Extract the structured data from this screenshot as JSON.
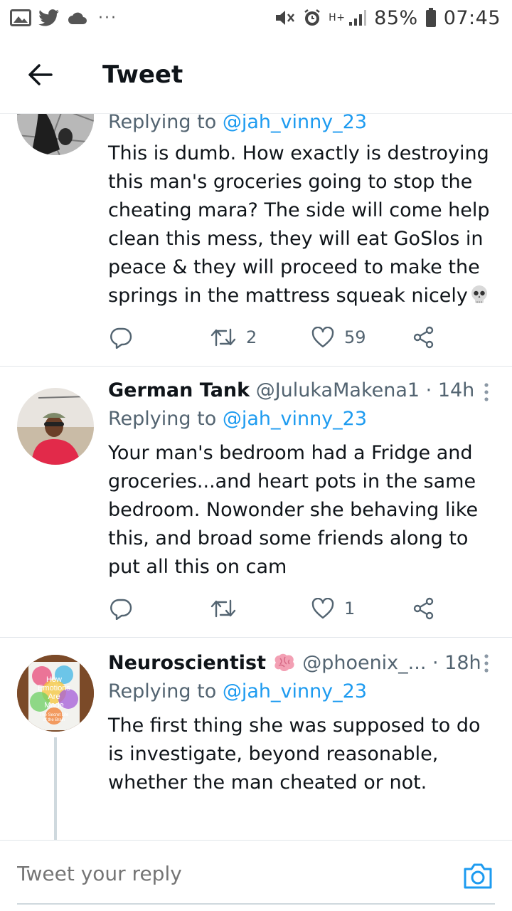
{
  "status_bar": {
    "battery": "85%",
    "time": "07:45",
    "network": "H+"
  },
  "header": {
    "title": "Tweet"
  },
  "tweets": [
    {
      "replying_prefix": "Replying to ",
      "replying_handle": "@jah_vinny_23",
      "text": "This is dumb. How exactly is destroying\nthis man's groceries going to stop the\ncheating mara? The side will come help\nclean this mess, they will eat GoSlos in\npeace & they will proceed to make the\nsprings in the mattress squeak nicely",
      "retweets": "2",
      "likes": "59"
    },
    {
      "name": "German Tank",
      "handle": "@JulukaMakena1",
      "time": "· 14h",
      "replying_prefix": "Replying to ",
      "replying_handle": "@jah_vinny_23",
      "text": "Your man's bedroom had a Fridge and\ngroceries...and heart pots in the same\nbedroom. Nowonder she behaving like\nthis, and broad some friends along to\nput all this on cam",
      "retweets": "",
      "likes": "1"
    },
    {
      "name": "Neuroscientist",
      "handle": "@phoenix_...",
      "time": "· 18h",
      "replying_prefix": "Replying to ",
      "replying_handle": "@jah_vinny_23",
      "text": "The first thing she was supposed to do\nis investigate, beyond reasonable,\nwhether the man cheated or not.",
      "avatar_book": {
        "line1": "How",
        "line2": "Emotions",
        "line3": "Are",
        "line4": "Made",
        "line5": "The Secret Life",
        "line6": "of the Brain"
      }
    }
  ],
  "reply_bar": {
    "placeholder": "Tweet your reply"
  },
  "colors": {
    "accent": "#1d9bf0",
    "secondary_text": "#536471",
    "primary_text": "#0f1419"
  }
}
